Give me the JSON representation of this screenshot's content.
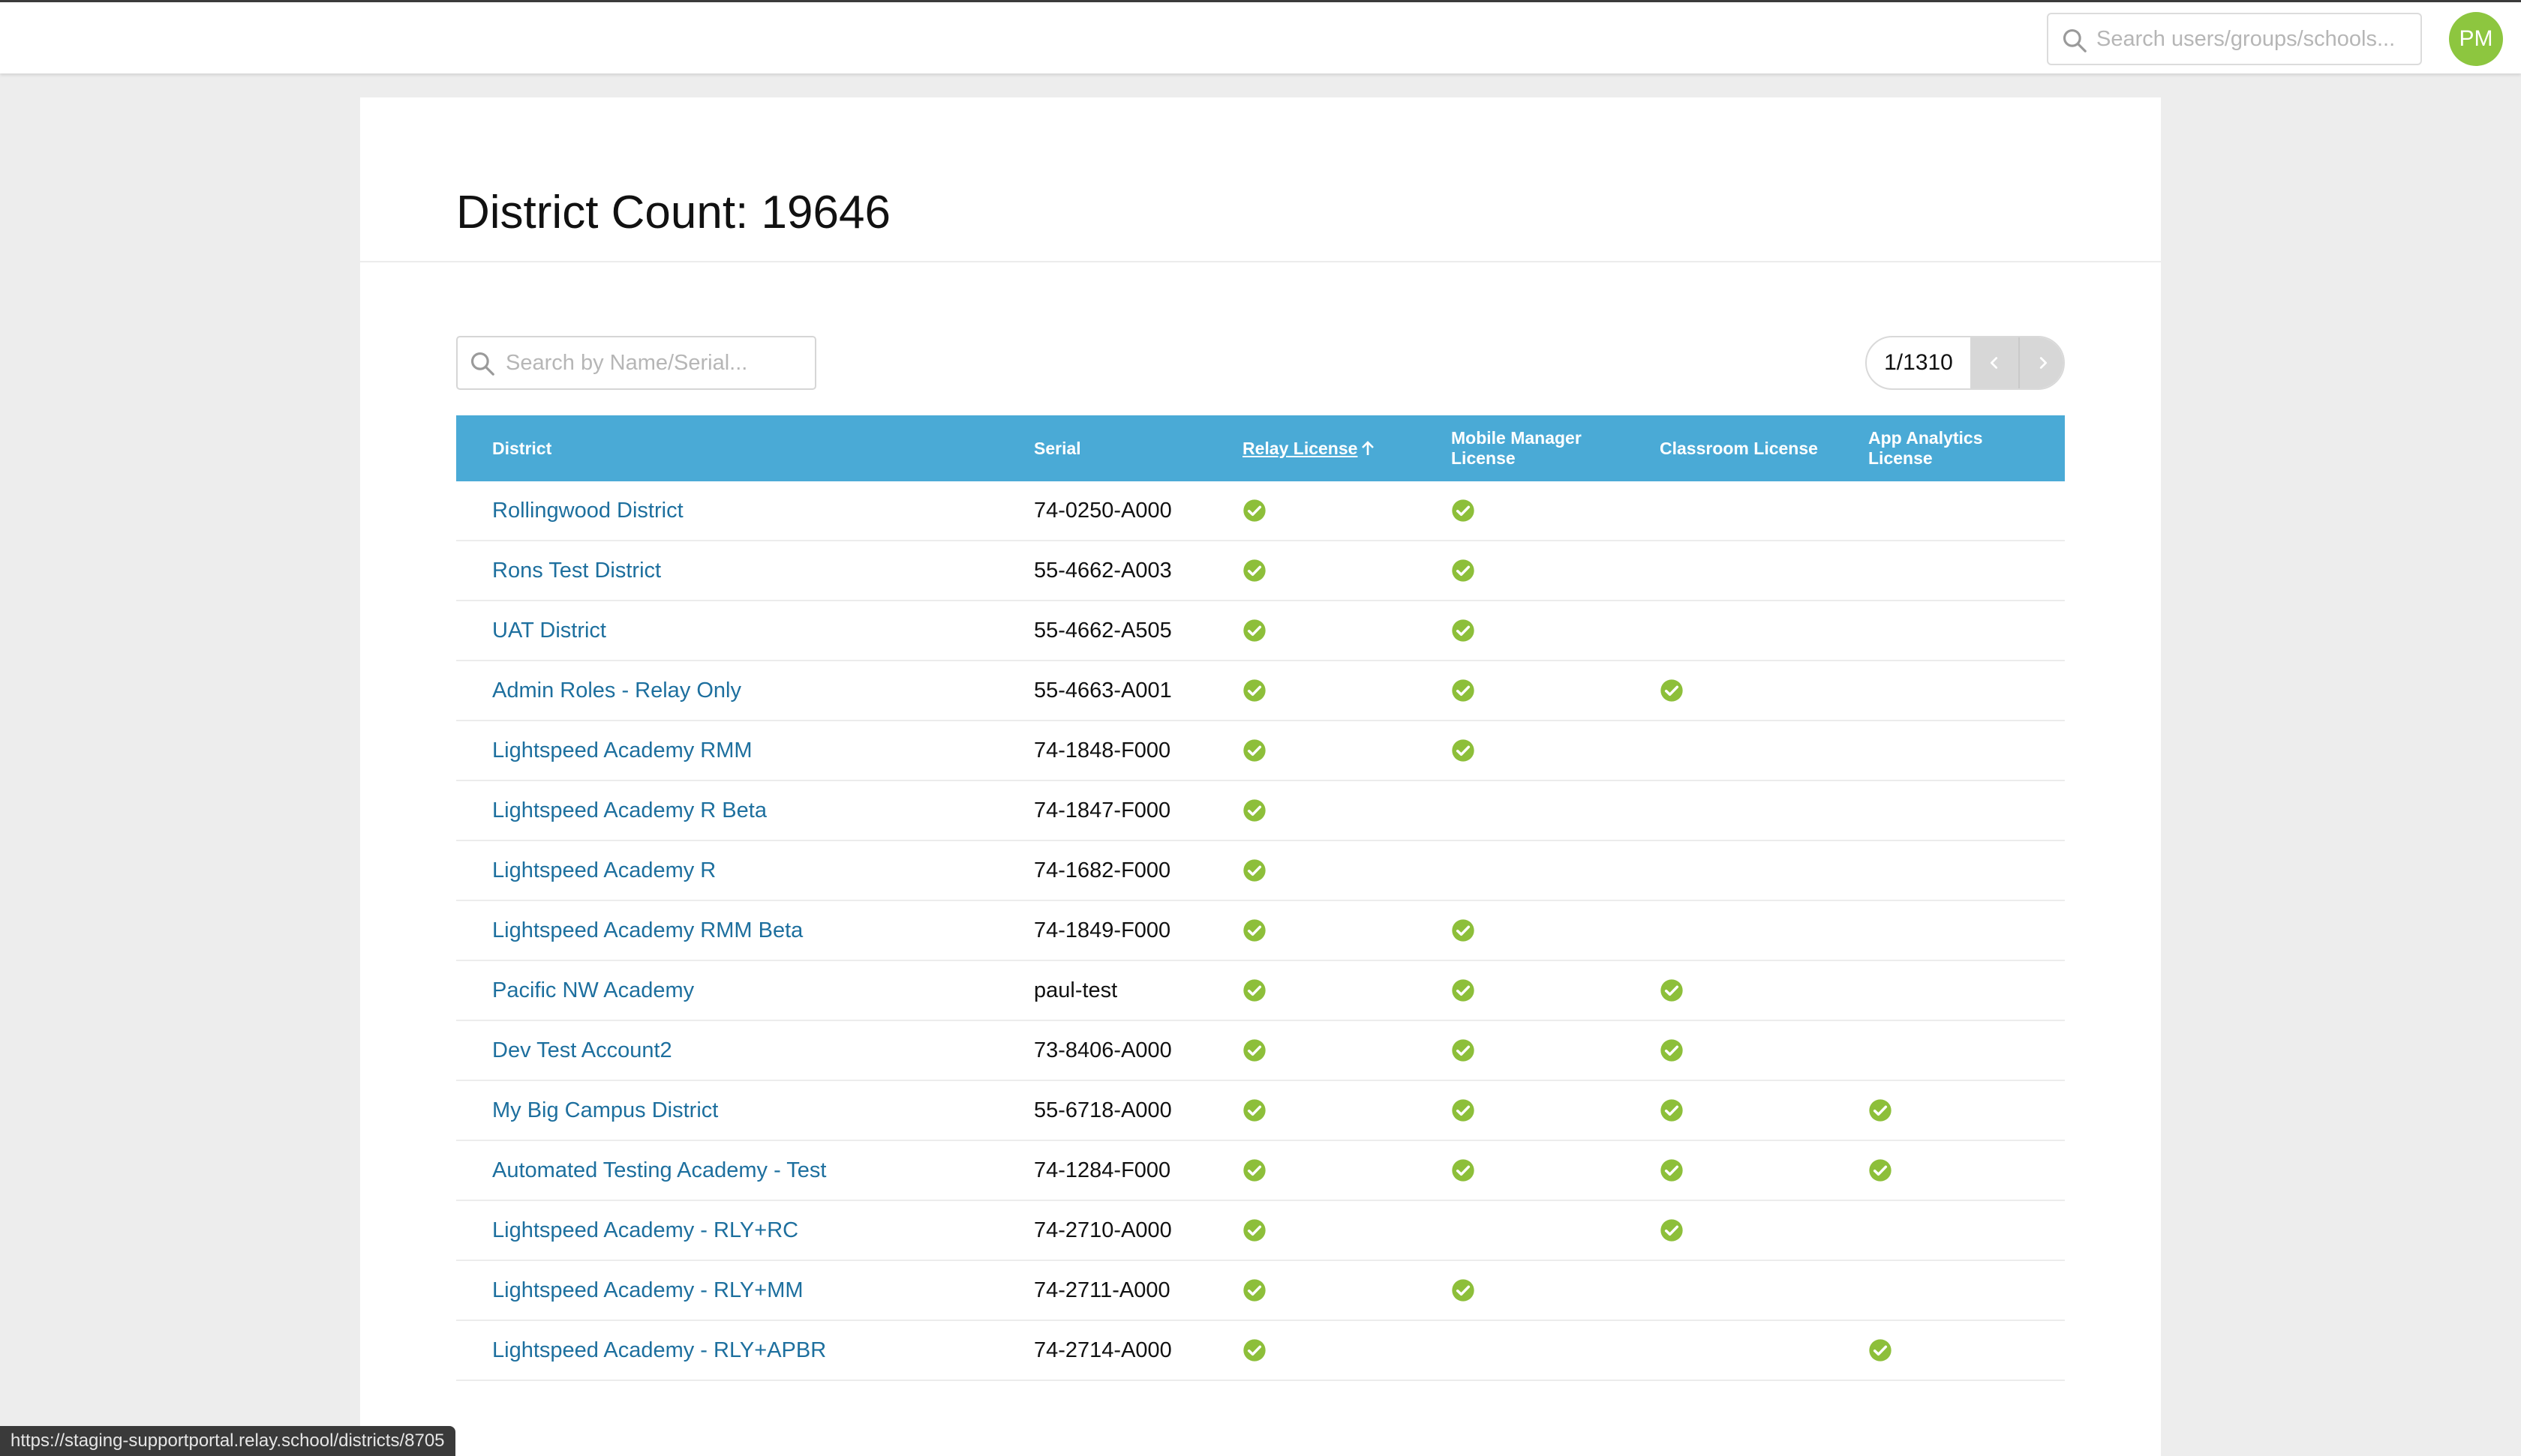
{
  "header": {
    "search_placeholder": "Search users/groups/schools...",
    "avatar_initials": "PM"
  },
  "page": {
    "title": "District Count: 19646",
    "search_placeholder": "Search by Name/Serial...",
    "pagination": "1/1310"
  },
  "table": {
    "columns": [
      "District",
      "Serial",
      "Relay License",
      "Mobile Manager License",
      "Classroom License",
      "App Analytics License"
    ],
    "sorted_column": "Relay License",
    "sort_direction": "ascending",
    "rows": [
      {
        "district": "Rollingwood District",
        "serial": "74-0250-A000",
        "relay": true,
        "mobile_manager": true,
        "classroom": false,
        "app_analytics": false
      },
      {
        "district": "Rons Test District",
        "serial": "55-4662-A003",
        "relay": true,
        "mobile_manager": true,
        "classroom": false,
        "app_analytics": false
      },
      {
        "district": "UAT District",
        "serial": "55-4662-A505",
        "relay": true,
        "mobile_manager": true,
        "classroom": false,
        "app_analytics": false
      },
      {
        "district": "Admin Roles - Relay Only",
        "serial": "55-4663-A001",
        "relay": true,
        "mobile_manager": true,
        "classroom": true,
        "app_analytics": false
      },
      {
        "district": "Lightspeed Academy RMM",
        "serial": "74-1848-F000",
        "relay": true,
        "mobile_manager": true,
        "classroom": false,
        "app_analytics": false
      },
      {
        "district": "Lightspeed Academy R Beta",
        "serial": "74-1847-F000",
        "relay": true,
        "mobile_manager": false,
        "classroom": false,
        "app_analytics": false
      },
      {
        "district": "Lightspeed Academy R",
        "serial": "74-1682-F000",
        "relay": true,
        "mobile_manager": false,
        "classroom": false,
        "app_analytics": false
      },
      {
        "district": "Lightspeed Academy RMM Beta",
        "serial": "74-1849-F000",
        "relay": true,
        "mobile_manager": true,
        "classroom": false,
        "app_analytics": false
      },
      {
        "district": "Pacific NW Academy",
        "serial": "paul-test",
        "relay": true,
        "mobile_manager": true,
        "classroom": true,
        "app_analytics": false
      },
      {
        "district": "Dev Test Account2",
        "serial": "73-8406-A000",
        "relay": true,
        "mobile_manager": true,
        "classroom": true,
        "app_analytics": false
      },
      {
        "district": "My Big Campus District",
        "serial": "55-6718-A000",
        "relay": true,
        "mobile_manager": true,
        "classroom": true,
        "app_analytics": true
      },
      {
        "district": "Automated Testing Academy - Test",
        "serial": "74-1284-F000",
        "relay": true,
        "mobile_manager": true,
        "classroom": true,
        "app_analytics": true
      },
      {
        "district": "Lightspeed Academy - RLY+RC",
        "serial": "74-2710-A000",
        "relay": true,
        "mobile_manager": false,
        "classroom": true,
        "app_analytics": false
      },
      {
        "district": "Lightspeed Academy - RLY+MM",
        "serial": "74-2711-A000",
        "relay": true,
        "mobile_manager": true,
        "classroom": false,
        "app_analytics": false
      },
      {
        "district": "Lightspeed Academy - RLY+APBR",
        "serial": "74-2714-A000",
        "relay": true,
        "mobile_manager": false,
        "classroom": false,
        "app_analytics": true
      }
    ]
  },
  "status_bar": {
    "url": "https://staging-supportportal.relay.school/districts/8705"
  },
  "icons": {
    "search": "search-icon",
    "check": "check-circle-icon",
    "prev": "chevron-left-icon",
    "next": "chevron-right-icon",
    "sort": "arrow-up-icon"
  },
  "colors": {
    "header_bg": "#4aaad6",
    "link": "#1d6f9e",
    "check": "#8dbf3a",
    "avatar": "#8dc63f"
  }
}
